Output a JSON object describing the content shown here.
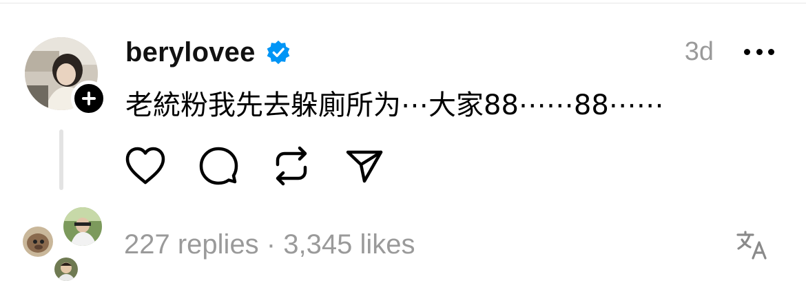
{
  "post": {
    "username": "berylovee",
    "verified": true,
    "timestamp": "3d",
    "text": "老統粉我先去躲廁所为⋯大家88⋯⋯88⋯⋯"
  },
  "stats": {
    "replies_text": "227 replies",
    "separator": " · ",
    "likes_text": "3,345 likes"
  },
  "actions": [
    "like",
    "reply",
    "repost",
    "share"
  ],
  "icons": {
    "verified": "verified-badge-icon",
    "more": "more-options-icon",
    "follow": "plus-icon",
    "translate": "translate-icon"
  },
  "colors": {
    "text_primary": "#000000",
    "text_secondary": "#9a9a9a",
    "verified_blue": "#0095f6",
    "thread_line": "#e3e3e3"
  }
}
